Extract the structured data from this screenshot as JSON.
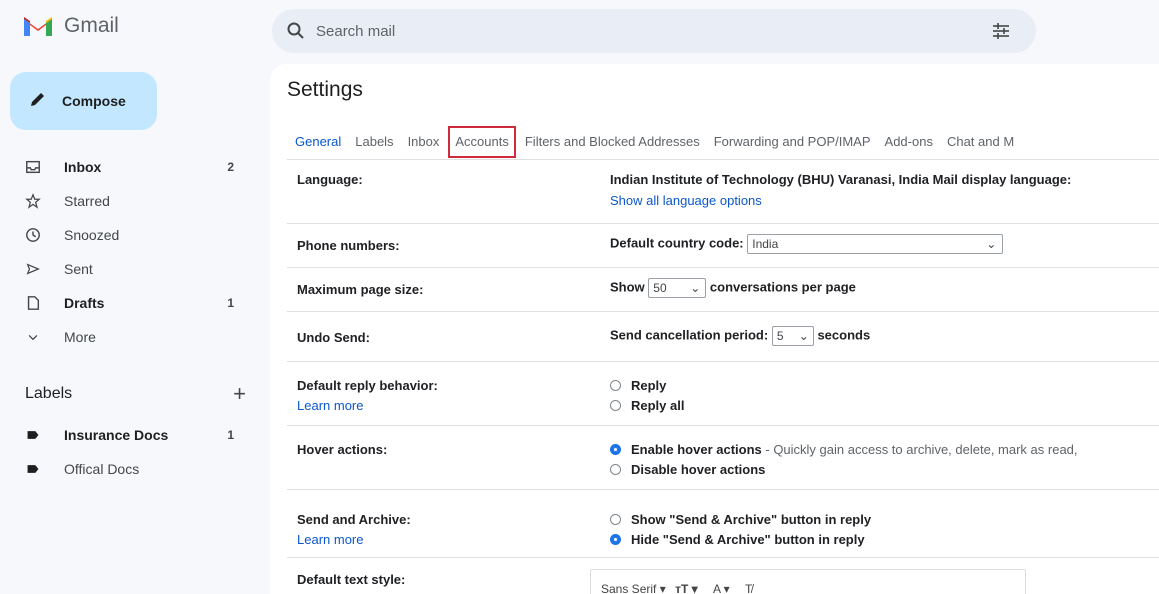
{
  "app": {
    "name": "Gmail"
  },
  "search": {
    "placeholder": "Search mail"
  },
  "compose": {
    "label": "Compose"
  },
  "nav": [
    {
      "label": "Inbox",
      "count": "2",
      "icon": "inbox-icon",
      "bold": true
    },
    {
      "label": "Starred",
      "count": "",
      "icon": "star-icon",
      "bold": false
    },
    {
      "label": "Snoozed",
      "count": "",
      "icon": "clock-icon",
      "bold": false
    },
    {
      "label": "Sent",
      "count": "",
      "icon": "send-icon",
      "bold": false
    },
    {
      "label": "Drafts",
      "count": "1",
      "icon": "draft-icon",
      "bold": true
    },
    {
      "label": "More",
      "count": "",
      "icon": "chevron-down-icon",
      "bold": false
    }
  ],
  "labels": {
    "title": "Labels",
    "items": [
      {
        "label": "Insurance Docs",
        "count": "1",
        "bold": true
      },
      {
        "label": "Offical Docs",
        "count": "",
        "bold": false
      }
    ]
  },
  "settings": {
    "title": "Settings",
    "tabs": [
      "General",
      "Labels",
      "Inbox",
      "Accounts",
      "Filters and Blocked Addresses",
      "Forwarding and POP/IMAP",
      "Add-ons",
      "Chat and M"
    ],
    "active_tab": "General",
    "highlighted_tab": "Accounts",
    "rows": {
      "language": {
        "label": "Language:",
        "value": "Indian Institute of Technology (BHU) Varanasi, India Mail display language:",
        "link": "Show all language options"
      },
      "phone": {
        "label": "Phone numbers:",
        "prefix": "Default country code:",
        "select": "India"
      },
      "page_size": {
        "label": "Maximum page size:",
        "prefix": "Show",
        "select": "50",
        "suffix": "conversations per page"
      },
      "undo": {
        "label": "Undo Send:",
        "prefix": "Send cancellation period:",
        "select": "5",
        "suffix": "seconds"
      },
      "reply": {
        "label": "Default reply behavior:",
        "learn": "Learn more",
        "options": [
          "Reply",
          "Reply all"
        ]
      },
      "hover": {
        "label": "Hover actions:",
        "option1": "Enable hover actions",
        "option1_desc": " - Quickly gain access to archive, delete, mark as read,",
        "option2": "Disable hover actions"
      },
      "send_archive": {
        "label": "Send and Archive:",
        "learn": "Learn more",
        "option1": "Show \"Send & Archive\" button in reply",
        "option2": "Hide \"Send & Archive\" button in reply"
      },
      "text_style": {
        "label": "Default text style:",
        "font": "Sans Serif"
      }
    }
  },
  "colors": {
    "accent": "#0b57d0",
    "compose_bg": "#c2e7ff",
    "highlight_border": "#cf2b3a",
    "app_bg": "#f6f8fc"
  }
}
